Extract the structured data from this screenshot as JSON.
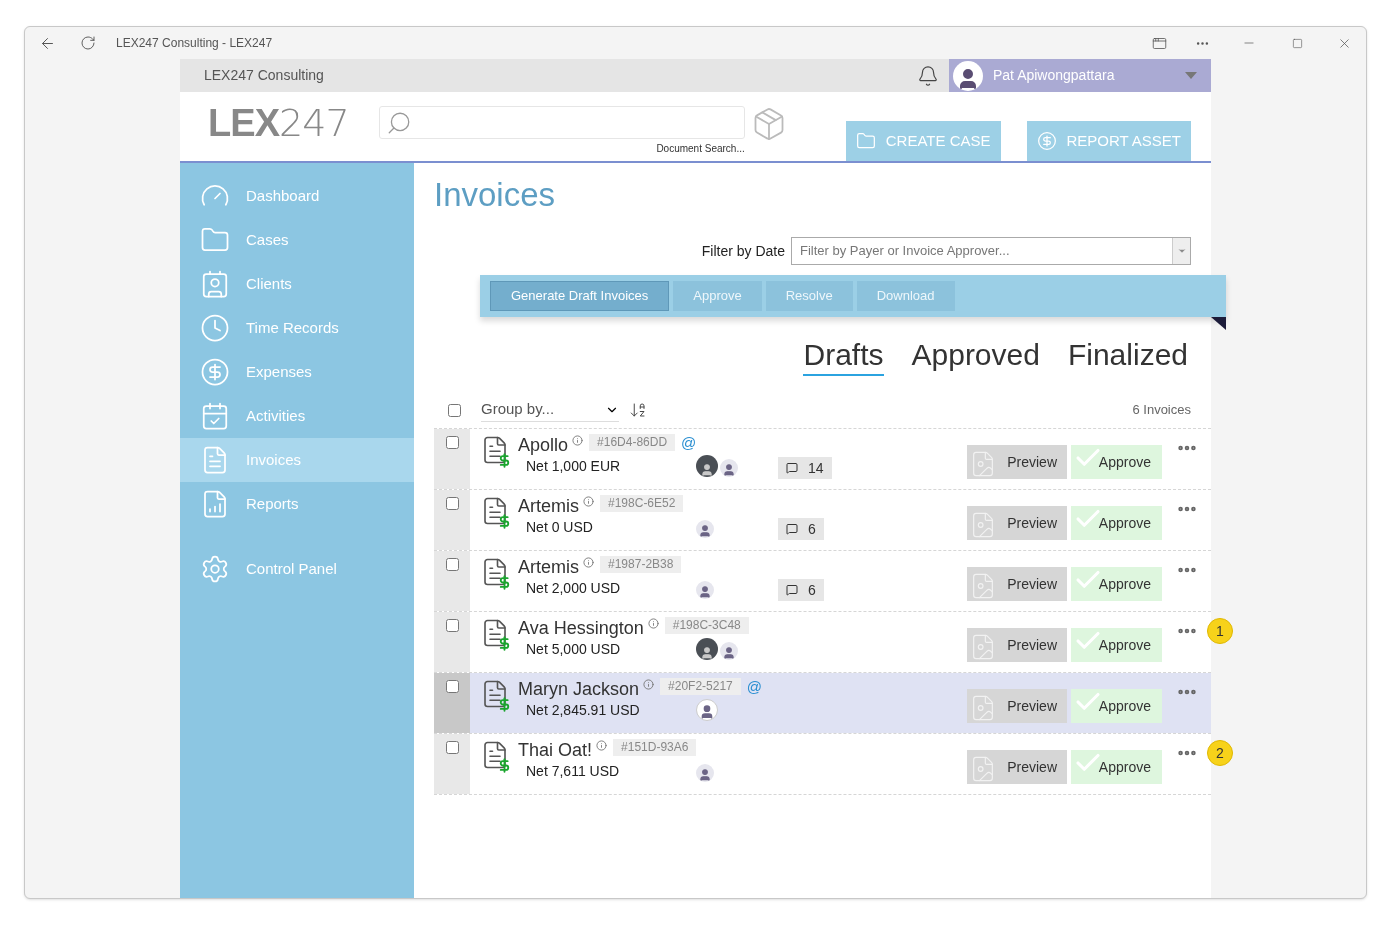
{
  "browser": {
    "title": "LEX247 Consulting - LEX247"
  },
  "top_bar": {
    "org": "LEX247 Consulting",
    "user": "Pat Apiwongpattara"
  },
  "header": {
    "logo_bold": "LEX",
    "logo_light": "247",
    "search_hint": "Document Search...",
    "actions": [
      {
        "kind": "folder",
        "label": "CREATE CASE"
      },
      {
        "kind": "dollar",
        "label": "REPORT ASSET"
      }
    ]
  },
  "sidebar": {
    "items": [
      {
        "kind": "dashboard",
        "label": "Dashboard",
        "selected": false
      },
      {
        "kind": "cases",
        "label": "Cases",
        "selected": false
      },
      {
        "kind": "clients",
        "label": "Clients",
        "selected": false
      },
      {
        "kind": "time",
        "label": "Time Records",
        "selected": false
      },
      {
        "kind": "expenses",
        "label": "Expenses",
        "selected": false
      },
      {
        "kind": "activities",
        "label": "Activities",
        "selected": false
      },
      {
        "kind": "invoices",
        "label": "Invoices",
        "selected": true
      },
      {
        "kind": "reports",
        "label": "Reports",
        "selected": false
      }
    ],
    "footer_items": [
      {
        "kind": "control",
        "label": "Control Panel",
        "selected": false
      }
    ]
  },
  "page": {
    "title": "Invoices",
    "filter_label": "Filter by Date",
    "filter_placeholder": "Filter by Payer or Invoice Approver...",
    "toolbar": [
      {
        "label": "Generate Draft Invoices",
        "disabled": false
      },
      {
        "label": "Approve",
        "disabled": true
      },
      {
        "label": "Resolve",
        "disabled": true
      },
      {
        "label": "Download",
        "disabled": true
      }
    ],
    "tabs": [
      {
        "label": "Drafts",
        "selected": true
      },
      {
        "label": "Approved",
        "selected": false
      },
      {
        "label": "Finalized",
        "selected": false
      }
    ],
    "group_by": "Group by...",
    "count": "6 Invoices",
    "select_all": false
  },
  "invoices": [
    {
      "name": "Apollo",
      "id": "#16D4-86DD",
      "mention": "@",
      "net": "Net 1,000 EUR",
      "approvers": [
        {
          "kind": "dark"
        },
        {
          "kind": "light"
        }
      ],
      "comments": "14",
      "preview": "Preview",
      "approve": "Approve",
      "checked": false,
      "selected": false
    },
    {
      "name": "Artemis",
      "id": "#198C-6E52",
      "net": "Net 0 USD",
      "approvers": [
        {
          "kind": "light"
        }
      ],
      "comments": "6",
      "preview": "Preview",
      "approve": "Approve",
      "checked": false,
      "selected": false
    },
    {
      "name": "Artemis",
      "id": "#1987-2B38",
      "net": "Net 2,000 USD",
      "approvers": [
        {
          "kind": "light"
        }
      ],
      "comments": "6",
      "preview": "Preview",
      "approve": "Approve",
      "checked": false,
      "selected": false
    },
    {
      "name": "Ava Hessington",
      "id": "#198C-3C48",
      "net": "Net 5,000 USD",
      "approvers": [
        {
          "kind": "dark"
        },
        {
          "kind": "light"
        }
      ],
      "preview": "Preview",
      "approve": "Approve",
      "checked": false,
      "selected": false,
      "badge": "1"
    },
    {
      "name": "Maryn Jackson",
      "id": "#20F2-5217",
      "mention": "@",
      "net": "Net 2,845.91 USD",
      "approvers": [
        {
          "kind": "framed"
        }
      ],
      "preview": "Preview",
      "approve": "Approve",
      "checked": false,
      "selected": true
    },
    {
      "name": "Thai Oat!",
      "id": "#151D-93A6",
      "net": "Net 7,611 USD",
      "approvers": [
        {
          "kind": "light"
        }
      ],
      "preview": "Preview",
      "approve": "Approve",
      "checked": false,
      "selected": false,
      "badge": "2"
    }
  ]
}
